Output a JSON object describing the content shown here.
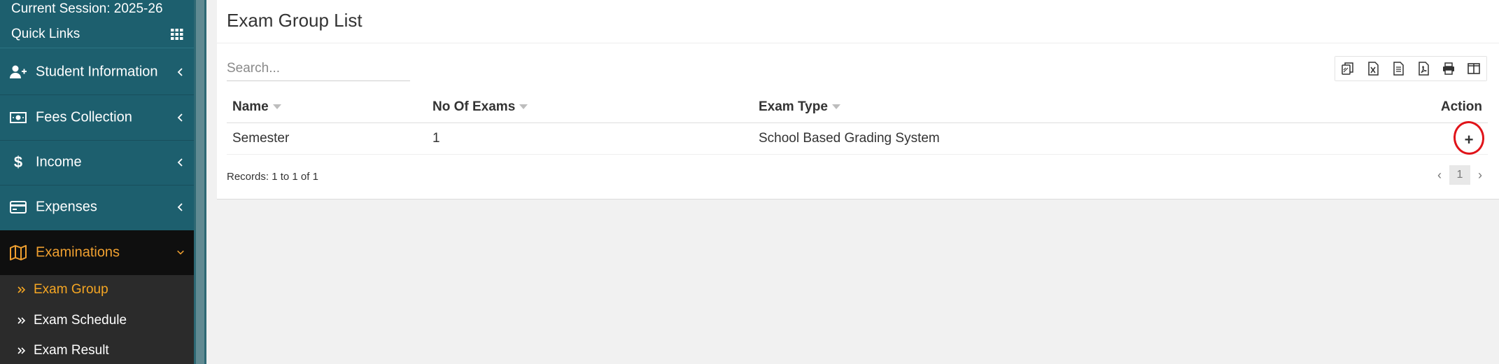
{
  "sidebar": {
    "session": "Current Session: 2025-26",
    "quick_links": "Quick Links",
    "items": [
      {
        "label": "Student Information",
        "icon": "user-plus-icon"
      },
      {
        "label": "Fees Collection",
        "icon": "money-icon"
      },
      {
        "label": "Income",
        "icon": "dollar-icon"
      },
      {
        "label": "Expenses",
        "icon": "credit-card-icon"
      },
      {
        "label": "Examinations",
        "icon": "map-icon"
      }
    ],
    "submenu": [
      {
        "label": "Exam Group"
      },
      {
        "label": "Exam Schedule"
      },
      {
        "label": "Exam Result"
      }
    ]
  },
  "main": {
    "title": "Exam Group List",
    "search_placeholder": "Search...",
    "toolbar": [
      "copy-icon",
      "excel-icon",
      "csv-icon",
      "pdf-icon",
      "print-icon",
      "columns-icon"
    ],
    "table": {
      "headers": [
        "Name",
        "No Of Exams",
        "Exam Type",
        "Action"
      ],
      "rows": [
        {
          "name": "Semester",
          "exams": "1",
          "type": "School Based Grading System",
          "action": "+"
        }
      ]
    },
    "records": "Records: 1 to 1 of 1",
    "pagination": {
      "prev": "‹",
      "current": "1",
      "next": "›"
    }
  },
  "colors": {
    "sidebar_bg": "#1d5f6e",
    "active_text": "#f5a623",
    "annotation_circle": "#e0141a"
  }
}
